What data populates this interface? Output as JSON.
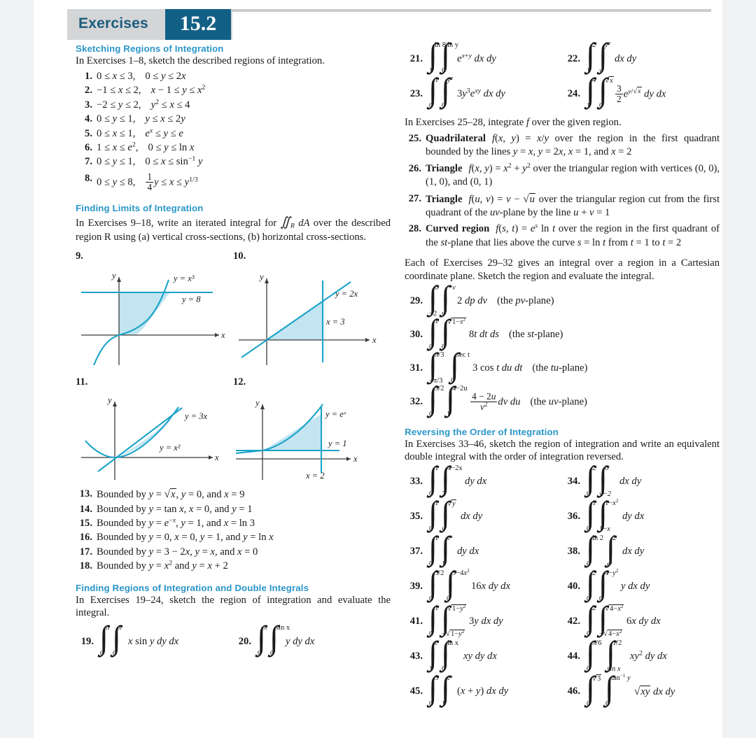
{
  "header": {
    "word": "Exercises",
    "number": "15.2"
  },
  "sections": {
    "sketching": {
      "heading": "Sketching Regions of Integration",
      "intro": "In Exercises 1–8, sketch the described regions of integration."
    },
    "limits": {
      "heading": "Finding Limits of Integration",
      "intro_a": "In Exercises 9–18, write an iterated integral for",
      "intro_b": "dA",
      "intro_c": "over the described region R using (a) vertical cross-sections, (b) horizontal cross-sections."
    },
    "regions_double": {
      "heading": "Finding Regions of Integration and Double Integrals",
      "intro": "In Exercises 19–24, sketch the region of integration and evaluate the integral."
    },
    "integrate_f": {
      "intro": "In Exercises 25–28, integrate f over the given region."
    },
    "cartesian": {
      "intro": "Each of Exercises 29–32 gives an integral over a region in a Cartesian coordinate plane. Sketch the region and evaluate the integral."
    },
    "reversing": {
      "heading": "Reversing the Order of Integration",
      "intro": "In Exercises 33–46, sketch the region of integration and write an equivalent double integral with the order of integration reversed."
    }
  },
  "problems_1_8": [
    {
      "n": "1.",
      "left": "0 ≤ x ≤ 3,",
      "right": "0 ≤ y ≤ 2x"
    },
    {
      "n": "2.",
      "left": "−1 ≤ x ≤ 2,",
      "right": "x − 1 ≤ y ≤ x²"
    },
    {
      "n": "3.",
      "left": "−2 ≤ y ≤ 2,",
      "right": "y² ≤ x ≤ 4"
    },
    {
      "n": "4.",
      "left": "0 ≤ y ≤ 1,",
      "right": "y ≤ x ≤ 2y"
    },
    {
      "n": "5.",
      "left": "0 ≤ x ≤ 1,",
      "right": "eˣ ≤ y ≤ e"
    },
    {
      "n": "6.",
      "left": "1 ≤ x ≤ e²,",
      "right": "0 ≤ y ≤ ln x"
    },
    {
      "n": "7.",
      "left": "0 ≤ y ≤ 1,",
      "right": "0 ≤ x ≤ sin⁻¹ y"
    },
    {
      "n": "8.",
      "left": "0 ≤ y ≤ 8,",
      "right": "¼ y ≤ x ≤ y^(1/3)"
    }
  ],
  "figures": [
    {
      "n": "9.",
      "xlabel": "x",
      "ylabel": "y",
      "curve_labels": [
        "y = x³",
        "y = 8"
      ],
      "description": "region between y = x cubed and the line y = 8 in the first quadrant"
    },
    {
      "n": "10.",
      "xlabel": "x",
      "ylabel": "y",
      "curve_labels": [
        "y = 2x",
        "x = 3"
      ],
      "description": "triangular region bounded by y = 2x, x = 3 and the x-axis"
    },
    {
      "n": "11.",
      "xlabel": "x",
      "ylabel": "y",
      "curve_labels": [
        "y = 3x",
        "y = x²"
      ],
      "description": "region between the line y = 3x and the parabola y = x squared"
    },
    {
      "n": "12.",
      "xlabel": "x",
      "ylabel": "y",
      "curve_labels": [
        "y = eˣ",
        "y = 1",
        "x = 2"
      ],
      "description": "region bounded by y = e to the x, y = 1 and x = 2"
    }
  ],
  "problems_13_18": [
    {
      "n": "13.",
      "text": "Bounded by y = √x, y = 0, and x = 9"
    },
    {
      "n": "14.",
      "text": "Bounded by y = tan x, x = 0, and y = 1"
    },
    {
      "n": "15.",
      "text": "Bounded by y = e⁻ˣ, y = 1, and x = ln 3"
    },
    {
      "n": "16.",
      "text": "Bounded by y = 0, x = 0, y = 1, and y = ln x"
    },
    {
      "n": "17.",
      "text": "Bounded by y = 3 − 2x, y = x, and x = 0"
    },
    {
      "n": "18.",
      "text": "Bounded by y = x² and y = x + 2"
    }
  ],
  "integrals_19_24": [
    {
      "n": "19.",
      "upper1": "π",
      "lower1": "0",
      "upper2": "x",
      "lower2": "0",
      "body": "x sin y dy dx"
    },
    {
      "n": "20.",
      "upper1": "π",
      "lower1": "0",
      "upper2": "sin x",
      "lower2": "0",
      "body": "y dy dx"
    },
    {
      "n": "21.",
      "upper1": "ln 8",
      "lower1": "1",
      "upper2": "ln y",
      "lower2": "0",
      "body": "e^{x+y} dx dy"
    },
    {
      "n": "22.",
      "upper1": "2",
      "lower1": "1",
      "upper2": "y²",
      "lower2": "y",
      "body": "dx dy"
    },
    {
      "n": "23.",
      "upper1": "1",
      "lower1": "0",
      "upper2": "y²",
      "lower2": "0",
      "body": "3y³e^{xy} dx dy"
    },
    {
      "n": "24.",
      "upper1": "4",
      "lower1": "1",
      "upper2": "√x",
      "lower2": "0",
      "body": "(3/2)e^{y/√x} dy dx"
    }
  ],
  "problems_25_28": [
    {
      "n": "25.",
      "title": "Quadrilateral",
      "text": "f(x, y) = x/y over the region in the first quadrant bounded by the lines y = x, y = 2x, x = 1, and x = 2"
    },
    {
      "n": "26.",
      "title": "Triangle",
      "text": "f(x, y) = x² + y² over the triangular region with vertices (0, 0), (1, 0), and (0, 1)"
    },
    {
      "n": "27.",
      "title": "Triangle",
      "text": "f(u, v) = v − √u over the triangular region cut from the first quadrant of the uv-plane by the line u + v = 1"
    },
    {
      "n": "28.",
      "title": "Curved region",
      "text": "f(s, t) = eˢ ln t over the region in the first quadrant of the st-plane that lies above the curve s = ln t from t = 1 to t = 2"
    }
  ],
  "integrals_29_32": [
    {
      "n": "29.",
      "upper1": "0",
      "lower1": "−2",
      "upper2": "−v",
      "lower2": "v",
      "body": "2 dp dv",
      "note": "(the pv-plane)"
    },
    {
      "n": "30.",
      "upper1": "1",
      "lower1": "0",
      "upper2": "√1−s²",
      "lower2": "0",
      "body": "8t dt ds",
      "note": "(the st-plane)"
    },
    {
      "n": "31.",
      "upper1": "π/3",
      "lower1": "−π/3",
      "upper2": "sec t",
      "lower2": "0",
      "body": "3 cos t du dt",
      "note": "(the tu-plane)"
    },
    {
      "n": "32.",
      "upper1": "3/2",
      "lower1": "0",
      "upper2": "4−2u",
      "lower2": "1",
      "body": "(4 − 2u)/v² dv du",
      "note": "(the uv-plane)"
    }
  ],
  "integrals_33_46": [
    {
      "n": "33.",
      "upper1": "1",
      "lower1": "0",
      "upper2": "4−2x",
      "lower2": "2",
      "body": "dy dx"
    },
    {
      "n": "34.",
      "upper1": "2",
      "lower1": "0",
      "upper2": "0",
      "lower2": "y−2",
      "body": "dx dy"
    },
    {
      "n": "35.",
      "upper1": "1",
      "lower1": "0",
      "upper2": "√y",
      "lower2": "y",
      "body": "dx dy"
    },
    {
      "n": "36.",
      "upper1": "1",
      "lower1": "0",
      "upper2": "1−x²",
      "lower2": "1−x",
      "body": "dy dx"
    },
    {
      "n": "37.",
      "upper1": "1",
      "lower1": "0",
      "upper2": "eˣ",
      "lower2": "1",
      "body": "dy dx"
    },
    {
      "n": "38.",
      "upper1": "ln 2",
      "lower1": "0",
      "upper2": "2",
      "lower2": "eˣ",
      "body": "dx dy"
    },
    {
      "n": "39.",
      "upper1": "3/2",
      "lower1": "0",
      "upper2": "9−4x²",
      "lower2": "0",
      "body": "16x dy dx"
    },
    {
      "n": "40.",
      "upper1": "2",
      "lower1": "0",
      "upper2": "4−y²",
      "lower2": "0",
      "body": "y dx dy"
    },
    {
      "n": "41.",
      "upper1": "1",
      "lower1": "0",
      "upper2": "√1−y²",
      "lower2": "−√1−y²",
      "body": "3y dx dy"
    },
    {
      "n": "42.",
      "upper1": "2",
      "lower1": "0",
      "upper2": "√4−x²",
      "lower2": "−√4−x²",
      "body": "6x dy dx"
    },
    {
      "n": "43.",
      "upper1": "e",
      "lower1": "1",
      "upper2": "ln x",
      "lower2": "0",
      "body": "xy dy dx"
    },
    {
      "n": "44.",
      "upper1": "π/6",
      "lower1": "0",
      "upper2": "1/2",
      "lower2": "sin x",
      "body": "xy² dy dx"
    },
    {
      "n": "45.",
      "upper1": "3",
      "lower1": "0",
      "upper2": "eᵛ",
      "lower2": "1",
      "body": "(x + y) dx dy"
    },
    {
      "n": "46.",
      "upper1": "√3",
      "lower1": "0",
      "upper2": "tan⁻¹ y",
      "lower2": "0",
      "body": "√xy dx dy"
    }
  ],
  "colors": {
    "accent_heading": "#2b96c8",
    "header_teal": "#125f86",
    "header_band": "#d3d5d7",
    "curve": "#1ba3c8",
    "shade": "#b8e0f0"
  }
}
